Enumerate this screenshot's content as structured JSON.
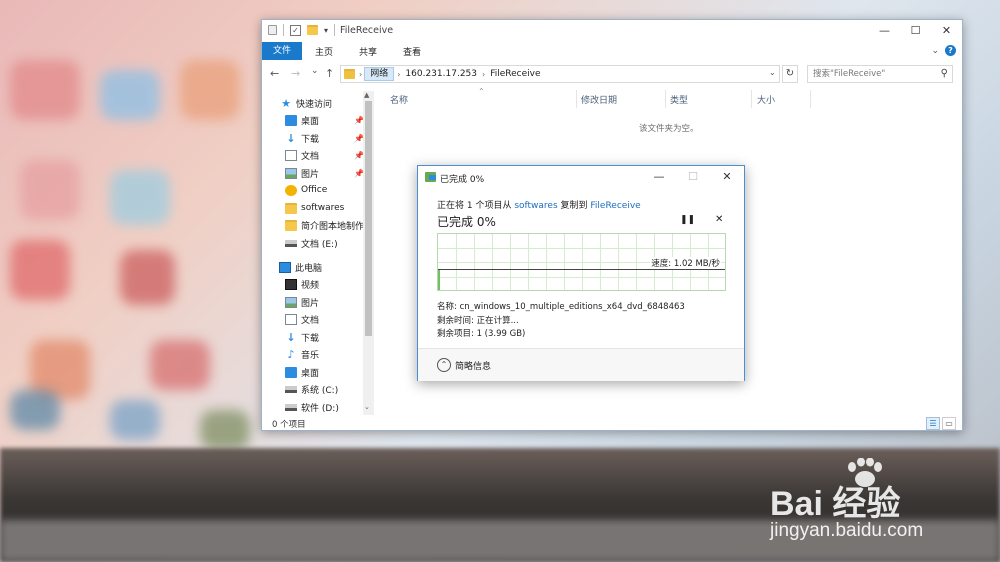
{
  "colors": {
    "accent": "#1979ca",
    "link": "#1a6dc1",
    "progress_green": "#6fc35f",
    "folder": "#f5c84c"
  },
  "explorer": {
    "title": "FileReceive",
    "window_controls": {
      "minimize": "—",
      "maximize": "☐",
      "close": "✕"
    },
    "ribbon": {
      "file_tab": "文件",
      "tabs": [
        "主页",
        "共享",
        "查看"
      ],
      "help": "?"
    },
    "address": {
      "back": "←",
      "forward": "→",
      "recent": "⌄",
      "up": "↑",
      "segments": [
        "网络",
        "160.231.17.253",
        "FileReceive"
      ],
      "search_placeholder": "搜索\"FileReceive\""
    },
    "nav_pane": [
      {
        "label": "快速访问",
        "icon": "star-icon",
        "pinned": false
      },
      {
        "label": "桌面",
        "icon": "desktop-icon",
        "pinned": true
      },
      {
        "label": "下载",
        "icon": "download-icon",
        "pinned": true
      },
      {
        "label": "文档",
        "icon": "document-icon",
        "pinned": true
      },
      {
        "label": "图片",
        "icon": "picture-icon",
        "pinned": true
      },
      {
        "label": "Office",
        "icon": "office-icon",
        "pinned": false
      },
      {
        "label": "softwares",
        "icon": "folder-icon",
        "pinned": false
      },
      {
        "label": "简介图本地制作",
        "icon": "folder-icon",
        "pinned": false
      },
      {
        "label": "文档 (E:)",
        "icon": "drive-icon",
        "pinned": false
      },
      {
        "label": "此电脑",
        "icon": "pc-icon",
        "pinned": false
      },
      {
        "label": "视频",
        "icon": "video-icon",
        "pinned": false
      },
      {
        "label": "图片",
        "icon": "picture-icon",
        "pinned": false
      },
      {
        "label": "文档",
        "icon": "document-icon",
        "pinned": false
      },
      {
        "label": "下载",
        "icon": "download-icon",
        "pinned": false
      },
      {
        "label": "音乐",
        "icon": "music-icon",
        "pinned": false
      },
      {
        "label": "桌面",
        "icon": "desktop-icon",
        "pinned": false
      },
      {
        "label": "系统 (C:)",
        "icon": "drive-icon",
        "pinned": false
      },
      {
        "label": "软件 (D:)",
        "icon": "drive-icon",
        "pinned": false
      }
    ],
    "columns": [
      "名称",
      "修改日期",
      "类型",
      "大小"
    ],
    "empty_message": "该文件夹为空。",
    "status": "0 个项目"
  },
  "dialog": {
    "title": "已完成 0%",
    "controls": {
      "minimize": "—",
      "maximize": "☐",
      "close": "✕"
    },
    "line_prefix": "正在将 1 个项目从 ",
    "source": "softwares",
    "line_mid": " 复制到 ",
    "target": "FileReceive",
    "progress_text": "已完成 0%",
    "progress_percent": 0,
    "pause": "❚❚",
    "stop": "✕",
    "speed": "速度: 1.02 MB/秒",
    "name_line": "名称: cn_windows_10_multiple_editions_x64_dvd_6848463",
    "time_left": "剩余时间: 正在计算...",
    "items_left": "剩余项目: 1 (3.99 GB)",
    "more_info": "简略信息"
  },
  "watermark": {
    "brand": "Bai  经验",
    "url": "jingyan.baidu.com"
  }
}
